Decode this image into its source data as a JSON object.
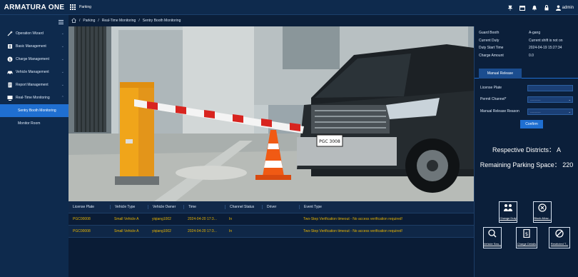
{
  "header": {
    "brand": "ARMATURA ONE",
    "module": "Parking",
    "user": "admin"
  },
  "breadcrumb": [
    "Parking",
    "Real-Time Monitoring",
    "Sentry Booth Monitoring"
  ],
  "sidebar": {
    "items": [
      {
        "label": "Operation Wizard",
        "icon": "wand-icon"
      },
      {
        "label": "Basic Management",
        "icon": "gear-icon"
      },
      {
        "label": "Charge Management",
        "icon": "coin-icon"
      },
      {
        "label": "Vehicle Management",
        "icon": "car-icon"
      },
      {
        "label": "Report Management",
        "icon": "report-icon"
      },
      {
        "label": "Real-Time Monitoring",
        "icon": "monitor-icon"
      }
    ],
    "subitems": [
      "Sentry Booth Monitoring",
      "Monitor Room"
    ]
  },
  "video": {
    "plate_text": "PGC 3008"
  },
  "table": {
    "columns": [
      "License Plate",
      "Vehicle Type",
      "Vehicle Owner",
      "Time",
      "Channel Status",
      "Driver",
      "Event Type"
    ],
    "rows": [
      [
        "PGC00008",
        "Small Vehicle A",
        "yiqiang1002",
        "2024-04-20 17:3...",
        "In",
        "",
        "Two-Step Verification timeout - No access verification required!"
      ],
      [
        "PGC00008",
        "Small Vehicle A",
        "yiqiang1002",
        "2024-04-20 17:3...",
        "In",
        "",
        "Two-Step Verification timeout - No access verification required!"
      ]
    ]
  },
  "info": [
    {
      "k": "Guard Booth",
      "v": "A-gang"
    },
    {
      "k": "Current Duty",
      "v": "Current shift is not on"
    },
    {
      "k": "Duty Start Time",
      "v": "2024-04-19 15:27:34"
    },
    {
      "k": "Charge Amount",
      "v": "0.0"
    }
  ],
  "manual_release": {
    "tab": "Manual Release",
    "license_label": "License Plate",
    "license_value": "",
    "channel_label": "Permit Channel*",
    "channel_value": "-----------",
    "reason_label": "Manual Release Reason",
    "reason_value": "-----------",
    "confirm": "Confirm"
  },
  "stats": {
    "district": "Respective Districts： A",
    "remaining": "Remaining Parking Space： 220"
  },
  "actions": [
    {
      "label": "Change Duty",
      "icon": "duty-icon"
    },
    {
      "label": "Block Allow...",
      "icon": "block-icon"
    },
    {
      "label": "Vehicle Sea...",
      "icon": "vehicle-search-icon"
    },
    {
      "label": "Charge Details",
      "icon": "charge-details-icon"
    },
    {
      "label": "Restricted T...",
      "icon": "restricted-icon"
    }
  ],
  "colors": {
    "accent": "#1f6fd1",
    "event_text": "#e8b400",
    "bg": "#0b1f3a"
  }
}
